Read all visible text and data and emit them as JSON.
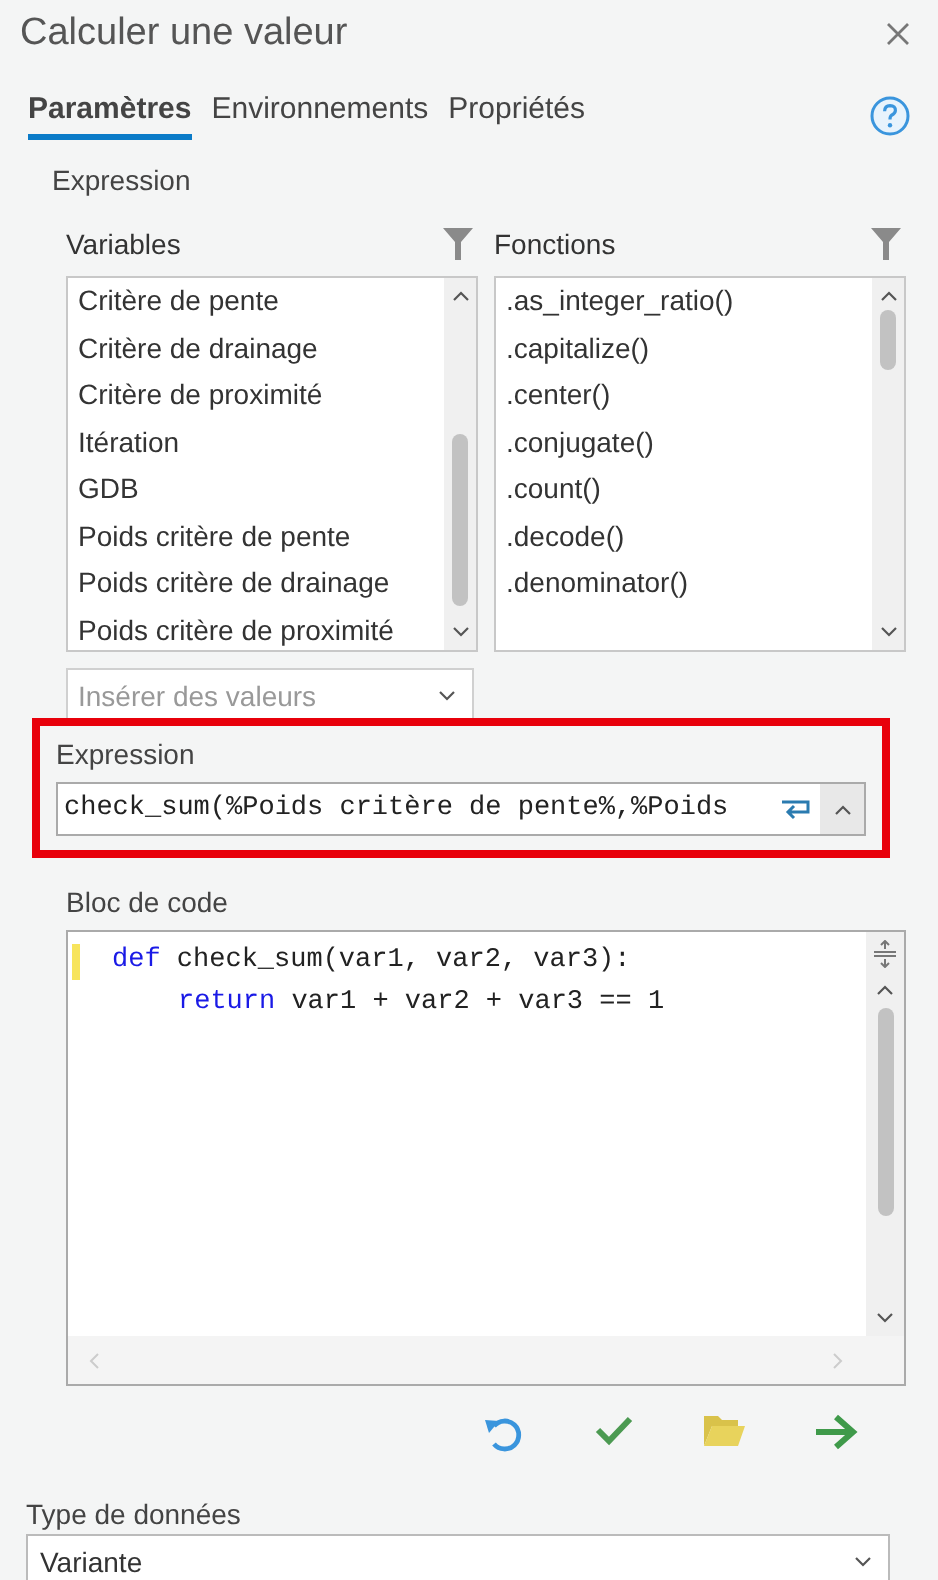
{
  "window": {
    "title": "Calculer une valeur"
  },
  "tabs": [
    {
      "label": "Paramètres",
      "selected": true
    },
    {
      "label": "Environnements",
      "selected": false
    },
    {
      "label": "Propriétés",
      "selected": false
    }
  ],
  "section_title": "Expression",
  "variables": {
    "title": "Variables",
    "items": [
      "Critère de pente",
      "Critère de drainage",
      "Critère de proximité",
      "Itération",
      "GDB",
      "Poids critère de pente",
      "Poids critère de drainage",
      "Poids critère de proximité"
    ]
  },
  "functions": {
    "title": "Fonctions",
    "items": [
      ".as_integer_ratio()",
      ".capitalize()",
      ".center()",
      ".conjugate()",
      ".count()",
      ".decode()",
      ".denominator()"
    ]
  },
  "insert_values": {
    "placeholder": "Insérer des valeurs",
    "disabled": true
  },
  "expression": {
    "label": "Expression",
    "value": "check_sum(%Poids critère de pente%,%Poids",
    "highlighted": true
  },
  "code_block": {
    "label": "Bloc de code",
    "lines": [
      {
        "keyword": "def",
        "text": " check_sum(var1, var2, var3):",
        "changed": true,
        "children": [
          {
            "keyword": "return",
            "text": " var1 + var2 + var3 == 1",
            "changed": false
          }
        ]
      }
    ]
  },
  "data_type": {
    "label": "Type de données",
    "value": "Variante"
  }
}
